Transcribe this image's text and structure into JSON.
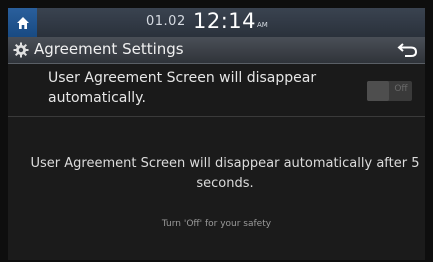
{
  "status_bar": {
    "date": "01.02",
    "time": "12:14",
    "ampm": "AM"
  },
  "header": {
    "title": "Agreement Settings"
  },
  "setting": {
    "label": "User Agreement Screen will disappear automatically.",
    "toggle_state": "Off"
  },
  "message": {
    "main": "User Agreement Screen will disappear automatically after 5 seconds.",
    "hint": "Turn 'Off' for your safety"
  },
  "icons": {
    "home": "home-icon",
    "settings": "gear-icon",
    "back": "back-arrow-icon"
  },
  "colors": {
    "home_button": "#1f5592",
    "status_bar": "#333b45",
    "title_bar": "#3c4148",
    "background": "#1b1b1b"
  }
}
